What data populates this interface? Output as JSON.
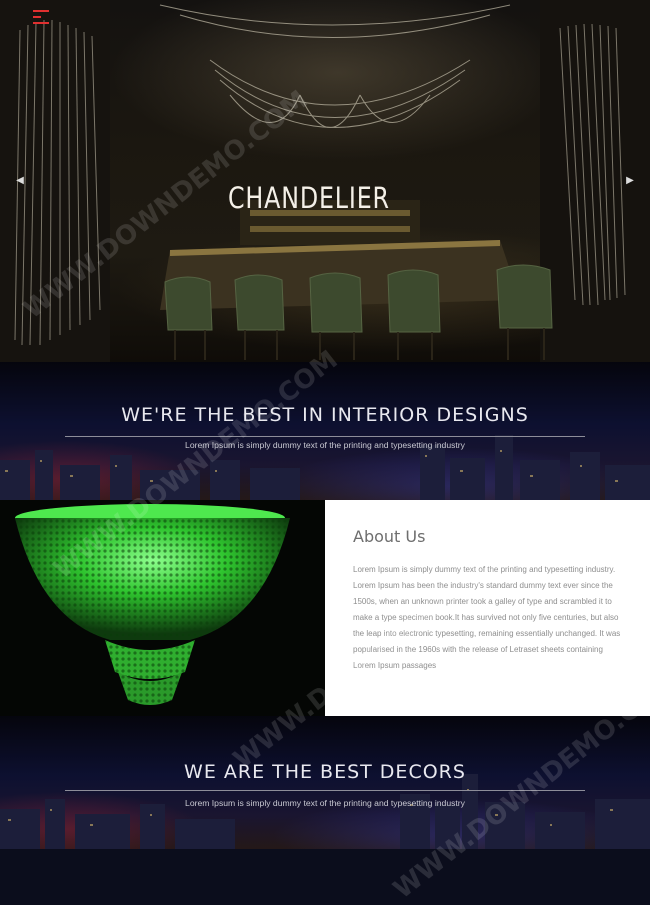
{
  "hero": {
    "title": "CHANDELIER",
    "prev_arrow": "◀",
    "next_arrow": "▶"
  },
  "band1": {
    "title": "WE'RE THE BEST IN INTERIOR DESIGNS",
    "text": "Lorem Ipsum is simply dummy text of the printing and typesetting industry"
  },
  "about": {
    "title": "About Us",
    "text": "Lorem Ipsum is simply dummy text of the printing and typesetting industry. Lorem Ipsum has been the industry's standard dummy text ever since the 1500s, when an unknown printer took a galley of type and scrambled it to make a type specimen book.It has survived not only five centuries, but also the leap into electronic typesetting, remaining essentially unchanged. It was popularised in the 1960s with the release of Letraset sheets containing Lorem Ipsum passages"
  },
  "band2": {
    "title": "WE ARE THE BEST DECORS",
    "text": "Lorem Ipsum is simply dummy text of the printing and typesetting industry"
  },
  "watermark": "WWW.DOWNDEMO.COM",
  "colors": {
    "menu_accent": "#e03030",
    "chandelier_green": "#3cd43c",
    "panel_bg": "#ffffff"
  }
}
